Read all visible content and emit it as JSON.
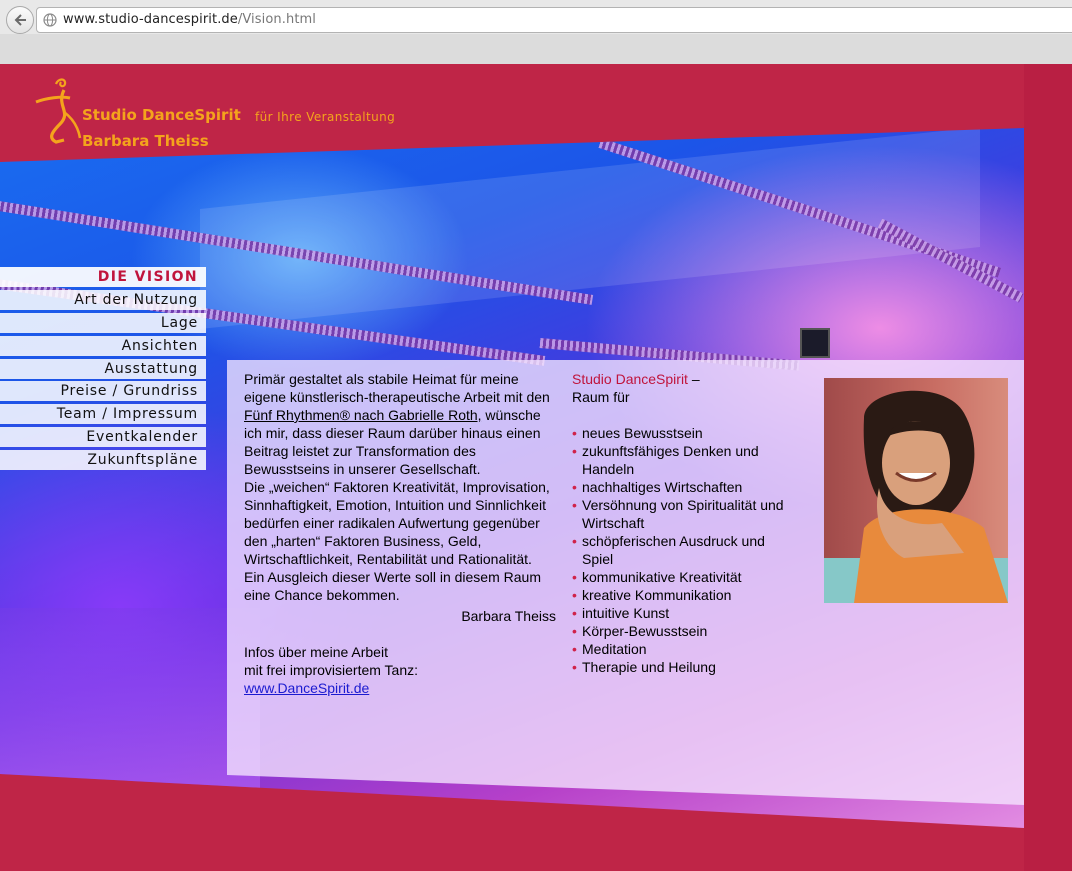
{
  "browser": {
    "url_host": "www.studio-dancespirit.de",
    "url_path": "/Vision.html"
  },
  "header": {
    "logo_line1": "Studio DanceSpirit",
    "logo_line2": "Barbara Theiss",
    "tagline": "für Ihre Veranstaltung"
  },
  "nav": {
    "items": [
      {
        "label": "DIE VISION"
      },
      {
        "label": "Art der Nutzung"
      },
      {
        "label": "Lage"
      },
      {
        "label": "Ansichten"
      },
      {
        "label": "Ausstattung"
      },
      {
        "label": "Preise / Grundriss"
      },
      {
        "label": "Team / Impressum"
      },
      {
        "label": "Eventkalender"
      },
      {
        "label": "Zukunftspläne"
      }
    ]
  },
  "main": {
    "intro_a": "Primär gestaltet als stabile Heimat für meine eigene künstlerisch-therapeutische Arbeit mit den ",
    "intro_link": "Fünf Rhythmen® nach Gabrielle Roth,",
    "intro_b": " wünsche ich mir, dass dieser Raum darüber hinaus einen Beitrag leistet zur Transformation des Bewusstseins in unserer Gesellschaft.",
    "para2": "Die „weichen“ Faktoren Kreativität, Improvisation, Sinnhaftigkeit, Emotion, Intuition und Sinnlichkeit bedürfen einer radikalen Aufwertung gegenüber den „harten“ Faktoren Business, Geld, Wirtschaftlichkeit, Rentabilität und Rationalität. Ein Ausgleich dieser Werte soll in diesem Raum eine Chance bekommen.",
    "signature": "Barbara Theiss",
    "infos_line1": "Infos über meine Arbeit",
    "infos_line2": "mit frei improvisiertem Tanz:",
    "infos_link": "www.DanceSpirit.de"
  },
  "sidebar_right": {
    "brand": "Studio DanceSpirit",
    "brand_dash": " –",
    "subtitle": "Raum für",
    "items": [
      "neues Bewusstsein",
      "zukunftsfähiges Denken und Handeln",
      "nachhaltiges Wirtschaften",
      "Versöhnung von Spiritualität und Wirtschaft",
      "schöpferischen Ausdruck und Spiel",
      "kommunikative Kreativität",
      "kreative Kommunikation",
      "intuitive Kunst",
      "Körper-Bewusstsein",
      "Meditation",
      "Therapie und Heilung"
    ]
  },
  "colors": {
    "brand_red": "#bf2547",
    "logo_orange": "#f4a41c",
    "active_nav": "#c0143c",
    "link_blue": "#1b1bd0"
  }
}
